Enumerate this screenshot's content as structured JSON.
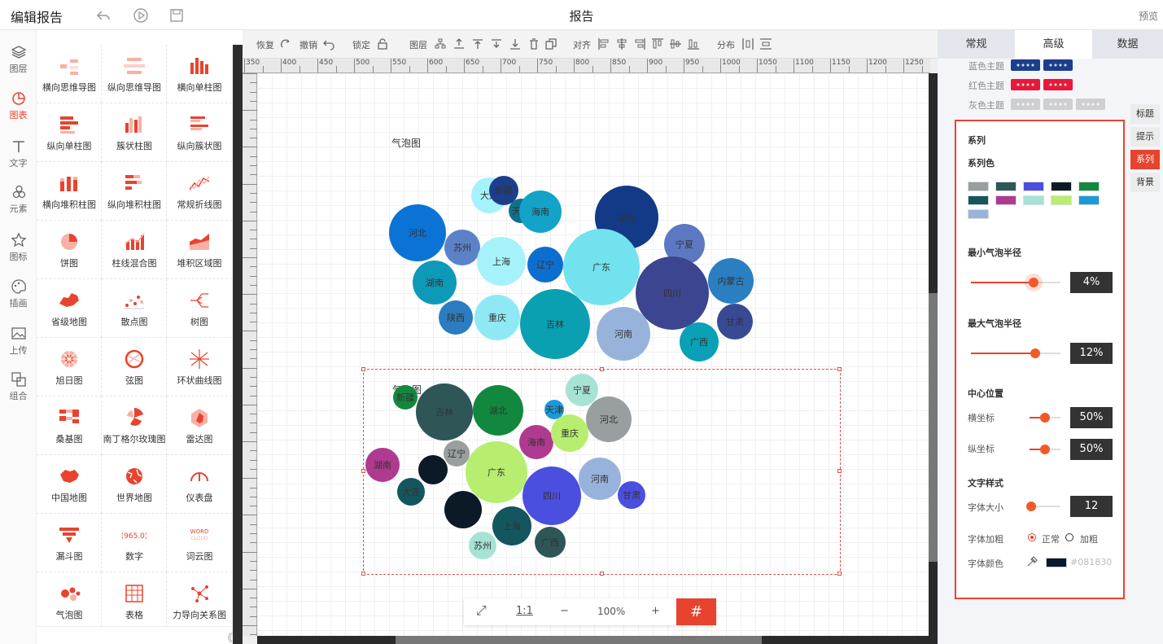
{
  "topbar": {
    "title": "编辑报告",
    "center_title": "报告",
    "preview": "预览"
  },
  "leftnav": [
    {
      "label": "图层",
      "icon": "layers-icon",
      "active": false
    },
    {
      "label": "图表",
      "icon": "pie-chart-icon",
      "active": true
    },
    {
      "label": "文字",
      "icon": "text-icon",
      "active": false
    },
    {
      "label": "元素",
      "icon": "shapes-icon",
      "active": false
    },
    {
      "label": "图标",
      "icon": "star-icon",
      "active": false
    },
    {
      "label": "插画",
      "icon": "palette-icon",
      "active": false
    },
    {
      "label": "上传",
      "icon": "image-upload-icon",
      "active": false
    },
    {
      "label": "组合",
      "icon": "group-icon",
      "active": false
    }
  ],
  "charts_grid": [
    [
      "横向思维导图",
      "纵向思维导图",
      "横向单柱图"
    ],
    [
      "纵向单柱图",
      "簇状柱图",
      "纵向簇状图"
    ],
    [
      "横向堆积柱图",
      "纵向堆积柱图",
      "常规折线图"
    ],
    [
      "饼图",
      "柱线混合图",
      "堆积区域图"
    ],
    [
      "省级地图",
      "散点图",
      "树图"
    ],
    [
      "旭日图",
      "弦图",
      "环状曲线图"
    ],
    [
      "桑基图",
      "南丁格尔玫瑰图",
      "雷达图"
    ],
    [
      "中国地图",
      "世界地图",
      "仪表盘"
    ],
    [
      "漏斗图",
      "数字",
      "词云图"
    ],
    [
      "气泡图",
      "表格",
      "力导向关系图"
    ]
  ],
  "toolbar": {
    "redo": "恢复",
    "undo": "撤销",
    "lock": "锁定",
    "layer": "图层",
    "align": "对齐",
    "distribute": "分布"
  },
  "ruler_ticks": [
    "350",
    "400",
    "450",
    "500",
    "550",
    "600",
    "650",
    "700",
    "750",
    "800",
    "850",
    "900",
    "950",
    "1000",
    "1050",
    "1100",
    "1150",
    "1200",
    "1250"
  ],
  "chart1": {
    "title": "气泡图",
    "bubbles": [
      {
        "label": "大连",
        "color": "#a6f2fb"
      },
      {
        "label": "新疆",
        "color": "#1c3e8c"
      },
      {
        "label": "天津",
        "color": "#116e8c"
      },
      {
        "label": "海南",
        "color": "#13a2c8"
      },
      {
        "label": "湖北",
        "color": "#123a86"
      },
      {
        "label": "河北",
        "color": "#0c73d6"
      },
      {
        "label": "苏州",
        "color": "#5b82c9"
      },
      {
        "label": "上海",
        "color": "#a6f2fb"
      },
      {
        "label": "辽宁",
        "color": "#0c6fd0"
      },
      {
        "label": "广东",
        "color": "#72e2ef"
      },
      {
        "label": "宁夏",
        "color": "#5d78c2"
      },
      {
        "label": "内蒙古",
        "color": "#2a7fc2"
      },
      {
        "label": "湖南",
        "color": "#0d9ab9"
      },
      {
        "label": "四川",
        "color": "#3c4590"
      },
      {
        "label": "陕西",
        "color": "#2b7cc0"
      },
      {
        "label": "重庆",
        "color": "#8fe9f4"
      },
      {
        "label": "吉林",
        "color": "#0aa0b2"
      },
      {
        "label": "河南",
        "color": "#98b3db"
      },
      {
        "label": "甘肃",
        "color": "#394a95"
      },
      {
        "label": "广西",
        "color": "#0aa0b6"
      }
    ]
  },
  "chart2": {
    "title": "气泡图",
    "bubbles": [
      {
        "label": "新疆",
        "color": "#12883e"
      },
      {
        "label": "吉林",
        "color": "#2f5657"
      },
      {
        "label": "湖北",
        "color": "#12883e"
      },
      {
        "label": "天津",
        "color": "#1b9ad9"
      },
      {
        "label": "宁夏",
        "color": "#a6e3d5"
      },
      {
        "label": "河北",
        "color": "#999ea1"
      },
      {
        "label": "海南",
        "color": "#b03a90"
      },
      {
        "label": "重庆",
        "color": "#b7ee70"
      },
      {
        "label": "辽宁",
        "color": "#999ea1"
      },
      {
        "label": "湖南",
        "color": "#b03a90"
      },
      {
        "label": "",
        "color": "#0b1a26"
      },
      {
        "label": "广东",
        "color": "#b7ee70"
      },
      {
        "label": "四川",
        "color": "#4a4fe0"
      },
      {
        "label": "河南",
        "color": "#98b3db"
      },
      {
        "label": "大连",
        "color": "#14565e"
      },
      {
        "label": "甘肃",
        "color": "#4a4fe0"
      },
      {
        "label": "",
        "color": "#0b1a26"
      },
      {
        "label": "上海",
        "color": "#14565e"
      },
      {
        "label": "苏州",
        "color": "#a6e3d5"
      },
      {
        "label": "广西",
        "color": "#2f5657"
      }
    ]
  },
  "zoombar": {
    "fit": "⤢",
    "one": "1:1",
    "minus": "−",
    "zoom": "100%",
    "plus": "+"
  },
  "rightpanel": {
    "tabs": [
      "常规",
      "高级",
      "数据"
    ],
    "active_tab": "高级",
    "themes": [
      {
        "label": "蓝色主题",
        "colors": [
          "#1c3e8c",
          "#1c3e8c"
        ]
      },
      {
        "label": "红色主题",
        "colors": [
          "#e8183a",
          "#e8183a"
        ]
      },
      {
        "label": "灰色主题",
        "colors": [
          "#cfcfcf",
          "#cfcfcf",
          "#cfcfcf"
        ]
      }
    ],
    "series": {
      "section": "系列",
      "color_label": "系列色",
      "colors": [
        "#999ea1",
        "#2f5657",
        "#4a4fe0",
        "#0b1a26",
        "#12883e",
        "#14565e",
        "#b03a90",
        "#a6e3d5",
        "#b7ee70",
        "#1b9ad9",
        "#98b3db"
      ],
      "min_radius_label": "最小气泡半径",
      "min_radius": "4%",
      "min_radius_fraction": 0.7,
      "max_radius_label": "最大气泡半径",
      "max_radius": "12%",
      "max_radius_fraction": 0.72,
      "center_label": "中心位置",
      "x_label": "横坐标",
      "x_value": "50%",
      "x_fraction": 0.5,
      "y_label": "纵坐标",
      "y_value": "50%",
      "y_fraction": 0.5,
      "text_style_label": "文字样式",
      "font_size_label": "字体大小",
      "font_size": "12",
      "font_size_fraction": 0.05,
      "bold_label": "字体加粗",
      "normal": "正常",
      "bold": "加粗",
      "font_color_label": "字体颜色",
      "font_color": "#081830"
    },
    "side_tabs": [
      "标题",
      "提示",
      "系列",
      "背景"
    ],
    "active_side_tab": "系列"
  }
}
